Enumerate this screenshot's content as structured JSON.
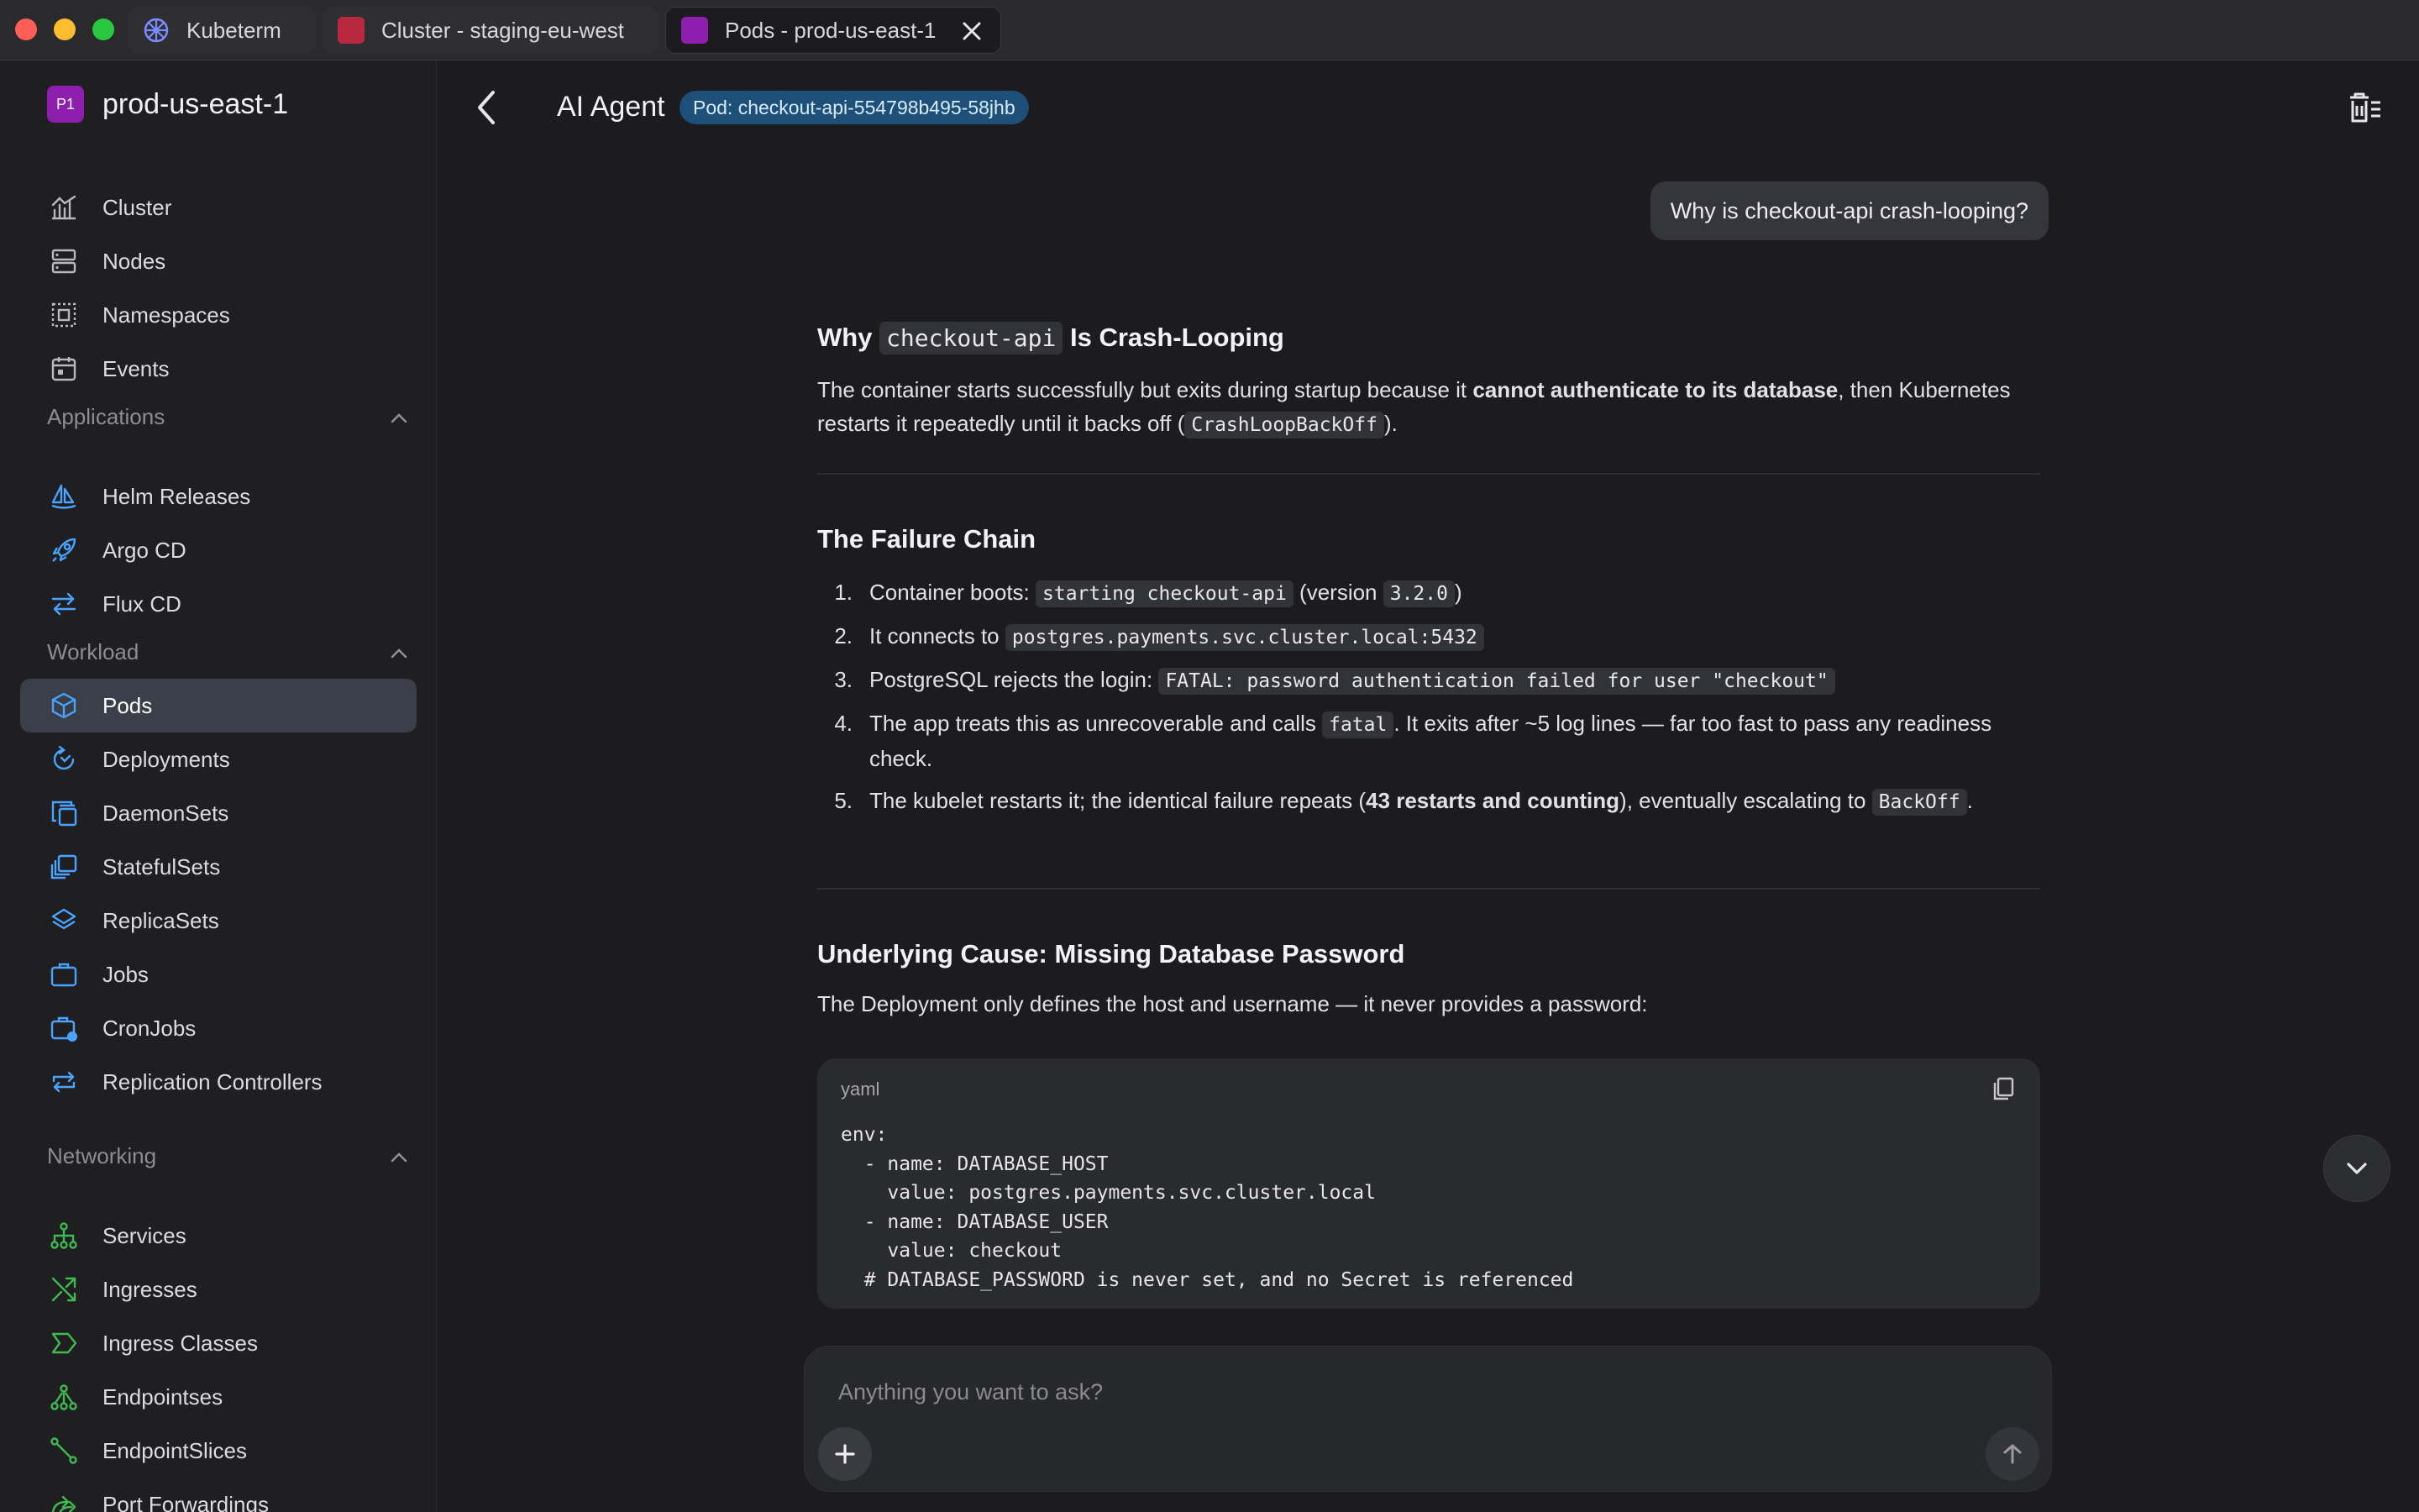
{
  "tabs": [
    {
      "label": "Kubeterm",
      "icon": "kubernetes-icon"
    },
    {
      "label": "Cluster - staging-eu-west",
      "icon": "cluster-color-icon",
      "color": "#b8293f"
    },
    {
      "label": "Pods - prod-us-east-1",
      "icon": "cluster-color-icon",
      "color": "#8e1fae",
      "active": true
    }
  ],
  "sidebar": {
    "cluster_badge": "P1",
    "cluster_name": "prod-us-east-1",
    "top_items": [
      "Cluster",
      "Nodes",
      "Namespaces",
      "Events"
    ],
    "applications": {
      "title": "Applications",
      "items": [
        "Helm Releases",
        "Argo CD",
        "Flux CD"
      ]
    },
    "workload": {
      "title": "Workload",
      "items": [
        "Pods",
        "Deployments",
        "DaemonSets",
        "StatefulSets",
        "ReplicaSets",
        "Jobs",
        "CronJobs",
        "Replication Controllers"
      ],
      "active": "Pods"
    },
    "networking": {
      "title": "Networking",
      "items": [
        "Services",
        "Ingresses",
        "Ingress Classes",
        "Endpointses",
        "EndpointSlices",
        "Port Forwardings"
      ]
    }
  },
  "header": {
    "title": "AI Agent",
    "pod_pill": "Pod: checkout-api-554798b495-58jhb"
  },
  "chat": {
    "user_message": "Why is checkout-api crash-looping?",
    "s1": {
      "h_pre": "Why ",
      "h_code": "checkout-api",
      "h_post": " Is Crash-Looping",
      "p_a": "The container starts successfully but exits during startup because it ",
      "p_b": "cannot authenticate to its database",
      "p_c": ", then Kubernetes restarts it repeatedly until it backs off (",
      "p_code": "CrashLoopBackOff",
      "p_d": ")."
    },
    "s2": {
      "heading": "The Failure Chain",
      "items": [
        {
          "num": "1.",
          "a": "Container boots: ",
          "code1": "starting checkout-api",
          "b": " (version ",
          "code2": "3.2.0",
          "c": ")"
        },
        {
          "num": "2.",
          "a": "It connects to ",
          "code1": "postgres.payments.svc.cluster.local:5432"
        },
        {
          "num": "3.",
          "a": "PostgreSQL rejects the login: ",
          "code1": "FATAL: password authentication failed for user \"checkout\""
        },
        {
          "num": "4.",
          "a": "The app treats this as unrecoverable and calls ",
          "code1": "fatal",
          "b": ". It exits after ~5 log lines — far too fast to pass any readiness check."
        },
        {
          "num": "5.",
          "a": "The kubelet restarts it; the identical failure repeats (",
          "bold": "43 restarts and counting",
          "b": "), eventually escalating to ",
          "code1": "BackOff",
          "c": "."
        }
      ]
    },
    "s3": {
      "heading": "Underlying Cause: Missing Database Password",
      "para": "The Deployment only defines the host and username — it never provides a password:"
    },
    "code_block": {
      "lang": "yaml",
      "lines": [
        "env:",
        "  - name: DATABASE_HOST",
        "    value: postgres.payments.svc.cluster.local",
        "  - name: DATABASE_USER",
        "    value: checkout",
        "  # DATABASE_PASSWORD is never set, and no Secret is referenced"
      ]
    }
  },
  "composer": {
    "placeholder": "Anything you want to ask?"
  },
  "colors": {
    "accent_blue": "#4aa3ff",
    "green_icon": "#3fb950",
    "active_nav": "#3a3f4a",
    "pill_bg": "#1d4f78"
  }
}
